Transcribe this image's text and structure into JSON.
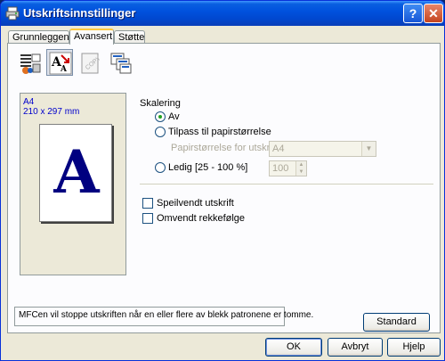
{
  "window": {
    "title": "Utskriftsinnstillinger",
    "help_glyph": "?",
    "close_glyph": "✕"
  },
  "tabs": [
    {
      "label": "Grunnleggende"
    },
    {
      "label": "Avansert"
    },
    {
      "label": "Støtte"
    }
  ],
  "icon_toolbar": [
    {
      "icon": "print-quality-icon"
    },
    {
      "icon": "scaling-icon"
    },
    {
      "icon": "watermark-copy-icon"
    },
    {
      "icon": "page-settings-icon"
    }
  ],
  "preview": {
    "paper": "A4",
    "size": "210 x 297 mm",
    "letter": "A"
  },
  "scaling": {
    "heading": "Skalering",
    "off_label": "Av",
    "fit_label": "Tilpass til papirstørrelse",
    "paper_size_label": "Papirstørrelse for utskrift",
    "paper_size_value": "A4",
    "free_label": "Ledig [25 - 100 %]",
    "free_value": "100",
    "selected": "Av"
  },
  "options": {
    "mirror_label": "Speilvendt utskrift",
    "mirror_checked": false,
    "reverse_label": "Omvendt rekkefølge",
    "reverse_checked": false
  },
  "status_text": "MFCen vil stoppe utskriften når en eller flere av blekk patronene er tomme.",
  "buttons": {
    "standard": "Standard",
    "ok": "OK",
    "cancel": "Avbryt",
    "help": "Hjelp"
  },
  "colors": {
    "titlebar": "#0052de",
    "preview_text": "#0000cc",
    "preview_letter": "#000080"
  }
}
